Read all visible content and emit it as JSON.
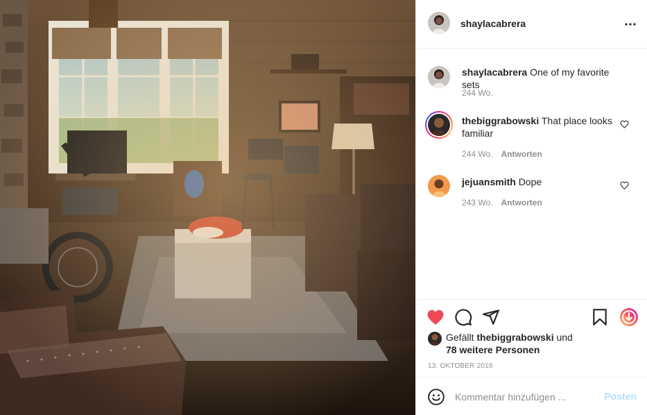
{
  "post": {
    "author": "shaylacabrera",
    "photo_icon": "living-room-photo"
  },
  "caption": {
    "username": "shaylacabrera",
    "text": "One of my favorite sets",
    "time": "244 Wo."
  },
  "comments": [
    {
      "username": "thebiggrabowski",
      "text": "That place looks familiar",
      "time": "244 Wo.",
      "reply": "Antworten",
      "has_story_ring": true
    },
    {
      "username": "jejuansmith",
      "text": "Dope",
      "time": "243 Wo.",
      "reply": "Antworten",
      "has_story_ring": false
    }
  ],
  "likes": {
    "prefix": "Gefällt",
    "user": "thebiggrabowski",
    "joiner": "und",
    "others": "78 weitere Personen"
  },
  "date": "13. OKTOBER 2016",
  "add_comment": {
    "placeholder": "Kommentar hinzufügen ...",
    "post_label": "Posten"
  },
  "colors": {
    "like_red": "#ed4956",
    "post_blue_disabled": "#b2dffc",
    "meta_gray": "#8e8e8e"
  }
}
